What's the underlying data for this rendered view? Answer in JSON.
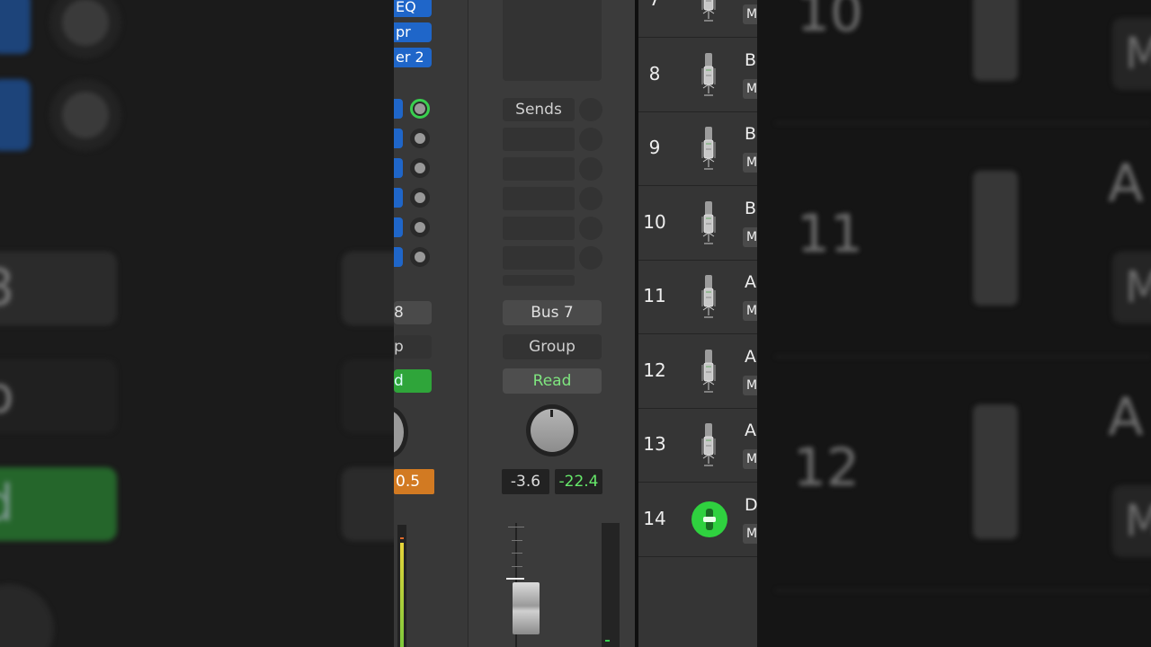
{
  "channel_left": {
    "plugins": [
      "EQ",
      "pr",
      "er 2"
    ],
    "output_label": "8",
    "group_label": "p",
    "automation_label": "d",
    "volume_value": "0.5"
  },
  "channel_bus7": {
    "sends_label": "Sends",
    "output_label": "Bus 7",
    "group_label": "Group",
    "automation_label": "Read",
    "volume_value": "-3.6",
    "peak_value": "-22.4",
    "fader_scale": [
      "0",
      "3",
      "6",
      "9",
      "12",
      "15",
      "18",
      "21",
      "24"
    ]
  },
  "tracks": [
    {
      "number": "7",
      "name": "",
      "icon": "microphone-icon"
    },
    {
      "number": "8",
      "name": "B",
      "icon": "microphone-icon"
    },
    {
      "number": "9",
      "name": "B",
      "icon": "microphone-icon"
    },
    {
      "number": "10",
      "name": "B",
      "icon": "microphone-icon"
    },
    {
      "number": "11",
      "name": "A",
      "icon": "microphone-icon"
    },
    {
      "number": "12",
      "name": "A",
      "icon": "microphone-icon"
    },
    {
      "number": "13",
      "name": "A",
      "icon": "microphone-icon"
    },
    {
      "number": "14",
      "name": "D",
      "icon": "drummer-icon"
    }
  ],
  "mute_label": "M",
  "background_left": {
    "output": "8",
    "group": "p",
    "automation": "d"
  },
  "background_right": {
    "numbers": [
      "10",
      "11",
      "12"
    ],
    "names": [
      "A",
      "A"
    ],
    "mutes": [
      "M",
      "M",
      "M"
    ]
  },
  "colors": {
    "plugin_blue": "#1f66c9",
    "read_green": "#7fe57f",
    "accent_green": "#39d04f",
    "volume_orange": "#d27a22"
  }
}
